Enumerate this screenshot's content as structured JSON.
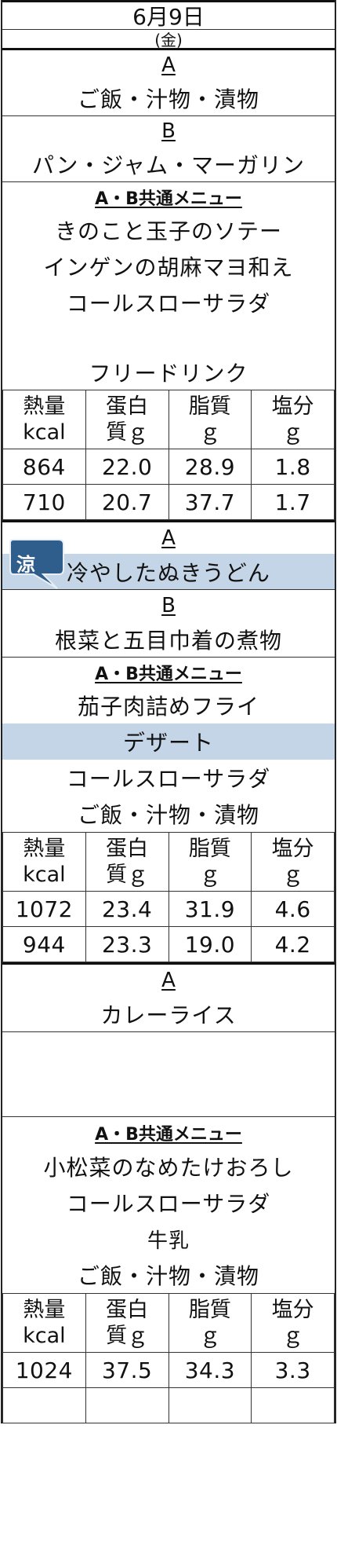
{
  "header": {
    "date": "6月9日",
    "weekday": "(金)"
  },
  "section1": {
    "label_a": "A",
    "a_items": [
      "ご飯・汁物・漬物"
    ],
    "label_b": "B",
    "b_items": [
      "パン・ジャム・マーガリン"
    ],
    "common_label": "A・B共通メニュー",
    "common_items": [
      "きのこと玉子のソテー",
      "インゲンの胡麻マヨ和え",
      "コールスローサラダ",
      "",
      "フリードリンク"
    ],
    "nutrition": {
      "headers": [
        "熱量\nkcal",
        "蛋白\n質ｇ",
        "脂質\nｇ",
        "塩分\nｇ"
      ],
      "rows": [
        [
          "864",
          "22.0",
          "28.9",
          "1.8"
        ],
        [
          "710",
          "20.7",
          "37.7",
          "1.7"
        ]
      ]
    }
  },
  "section2": {
    "badge_text": "涼",
    "badge_color": "#2f5d8c",
    "highlight_color": "#c5d5e8",
    "label_a": "A",
    "a_items": [
      "冷やしたぬきうどん"
    ],
    "label_b": "B",
    "b_items": [
      "根菜と五目巾着の煮物"
    ],
    "common_label": "A・B共通メニュー",
    "common_items": [
      "茄子肉詰めフライ",
      "デザート",
      "コールスローサラダ",
      "ご飯・汁物・漬物"
    ],
    "nutrition": {
      "headers": [
        "熱量\nkcal",
        "蛋白\n質ｇ",
        "脂質\nｇ",
        "塩分\nｇ"
      ],
      "rows": [
        [
          "1072",
          "23.4",
          "31.9",
          "4.6"
        ],
        [
          "944",
          "23.3",
          "19.0",
          "4.2"
        ]
      ]
    }
  },
  "section3": {
    "label_a": "A",
    "a_items": [
      "カレーライス"
    ],
    "common_label": "A・B共通メニュー",
    "common_items": [
      "小松菜のなめたけおろし",
      "コールスローサラダ",
      "牛乳",
      "ご飯・汁物・漬物"
    ],
    "nutrition": {
      "headers": [
        "熱量\nkcal",
        "蛋白\n質ｇ",
        "脂質\nｇ",
        "塩分\nｇ"
      ],
      "rows": [
        [
          "1024",
          "37.5",
          "34.3",
          "3.3"
        ]
      ]
    }
  }
}
